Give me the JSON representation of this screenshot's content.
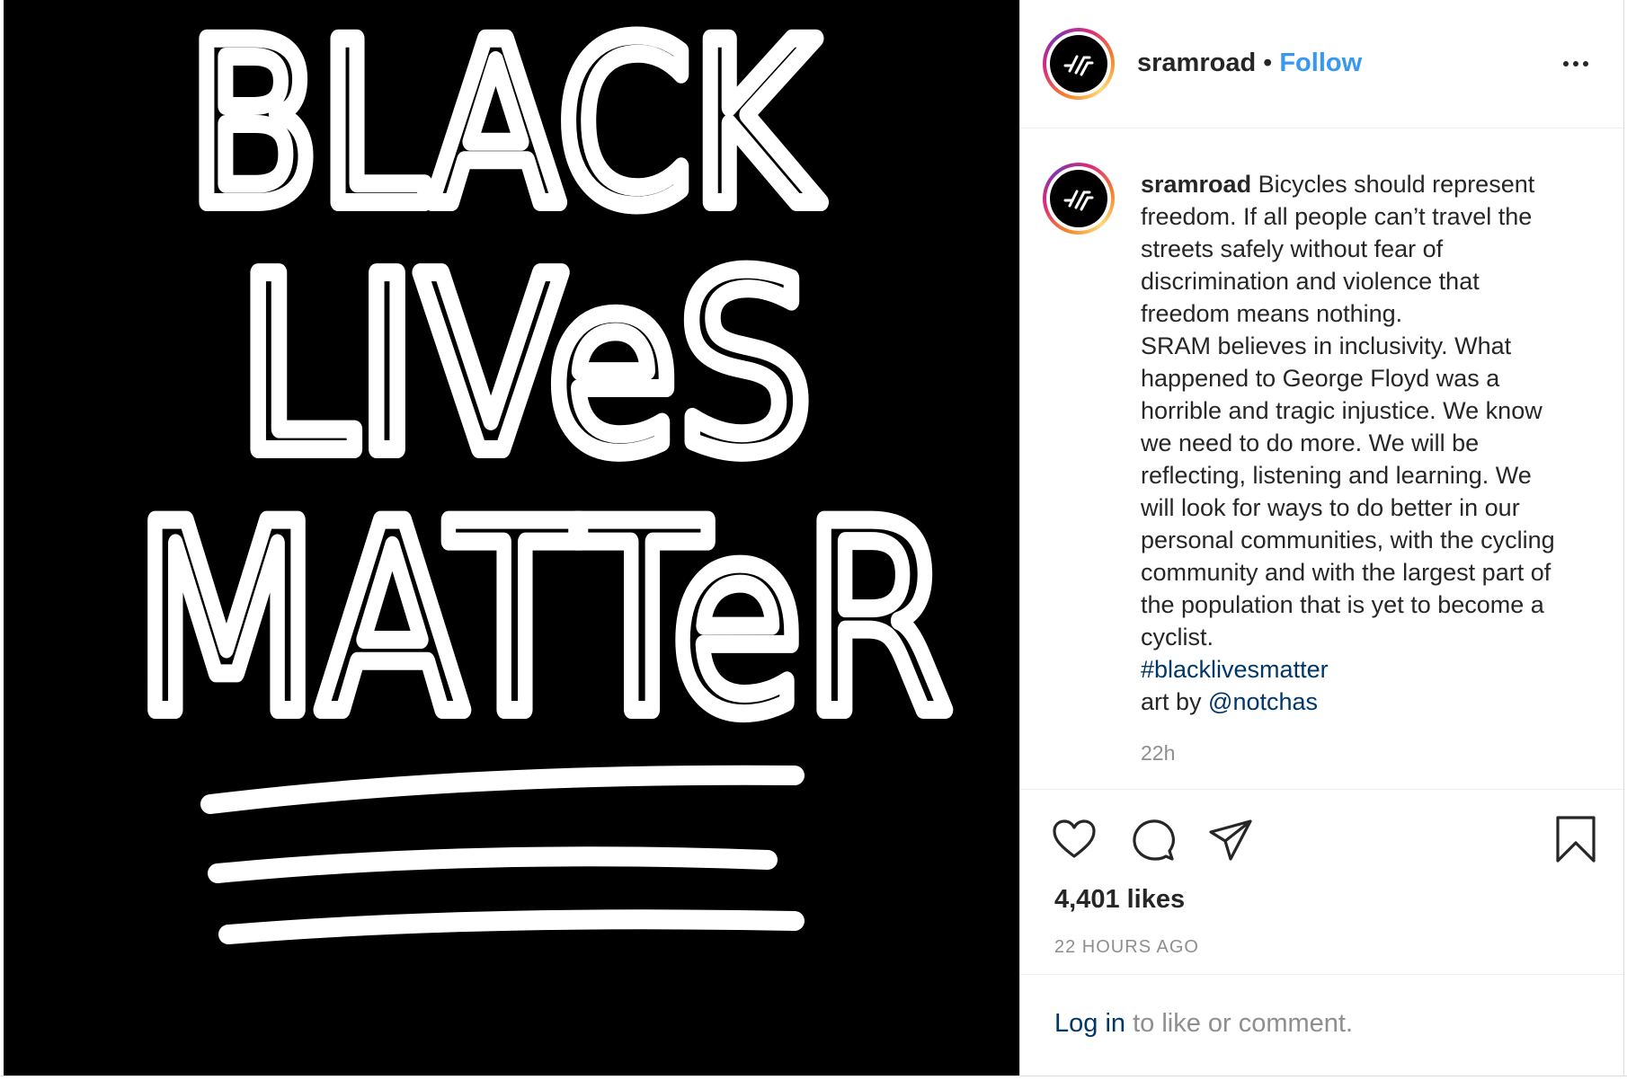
{
  "post_image": {
    "lines": [
      "BLACK",
      "LIVeS",
      "MATTeR"
    ]
  },
  "header": {
    "username": "sramroad",
    "separator": "•",
    "follow_label": "Follow",
    "more_icon": "more-horizontal-icon"
  },
  "caption": {
    "username": "sramroad",
    "lines": [
      "Bicycles should represent",
      "freedom. If all people can’t travel the",
      "streets safely without fear of",
      "discrimination and violence that",
      "freedom means nothing.",
      "SRAM believes in inclusivity. What",
      "happened to George Floyd was a",
      "horrible and tragic injustice. We know",
      "we need to do more. We will be",
      "reflecting, listening and learning. We",
      "will look for ways to do better in our",
      "personal communities, with the cycling",
      "community and with the largest part of",
      "the population that is yet to become a",
      "cyclist."
    ],
    "hashtag": "#blacklivesmatter",
    "credit_prefix": "art by",
    "credit_handle": "@notchas",
    "time": "22h"
  },
  "actions": {
    "like_icon": "heart-icon",
    "comment_icon": "comment-icon",
    "share_icon": "paper-plane-icon",
    "save_icon": "bookmark-icon",
    "likes": "4,401 likes",
    "timestamp": "22 HOURS AGO"
  },
  "login": {
    "link": "Log in",
    "suffix": "to like or comment."
  },
  "colors": {
    "follow": "#3897f0",
    "link": "#00376b",
    "muted": "#8e8e8e",
    "text": "#262626"
  }
}
